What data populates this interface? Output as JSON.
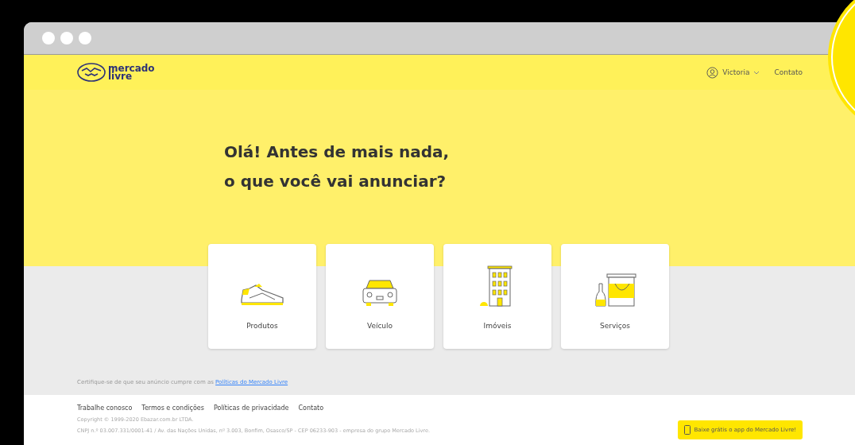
{
  "header": {
    "logo_line_1": "mercado",
    "logo_line_2": "livre",
    "user": "Victoria",
    "contact": "Contato"
  },
  "heading": {
    "line_1": "Olá! Antes de mais nada,",
    "line_2": "o que você vai anunciar?"
  },
  "categories": [
    {
      "kind": "shoe",
      "label": "Produtos"
    },
    {
      "kind": "car",
      "label": "Veículo"
    },
    {
      "kind": "building",
      "label": "Imóveis"
    },
    {
      "kind": "paint",
      "label": "Serviços"
    }
  ],
  "notice": {
    "text": "Certifique-se de que seu anúncio cumpre com as",
    "link": "Políticas do Mercado Livre"
  },
  "footer": {
    "links": [
      "Trabalhe conosco",
      "Termos e condições",
      "Políticas de privacidade",
      "Contato"
    ],
    "copyright": "Copyright © 1999-2020 Ebazar.com.br LTDA.",
    "address": "CNPJ n.º 03.007.331/0001-41 / Av. das Nações Unidas, nº 3.003, Bonfim, Osasco/SP - CEP 06233-903 - empresa do grupo Mercado Livre.",
    "app_button": "Baixe grátis o app do Mercado Livre!"
  }
}
